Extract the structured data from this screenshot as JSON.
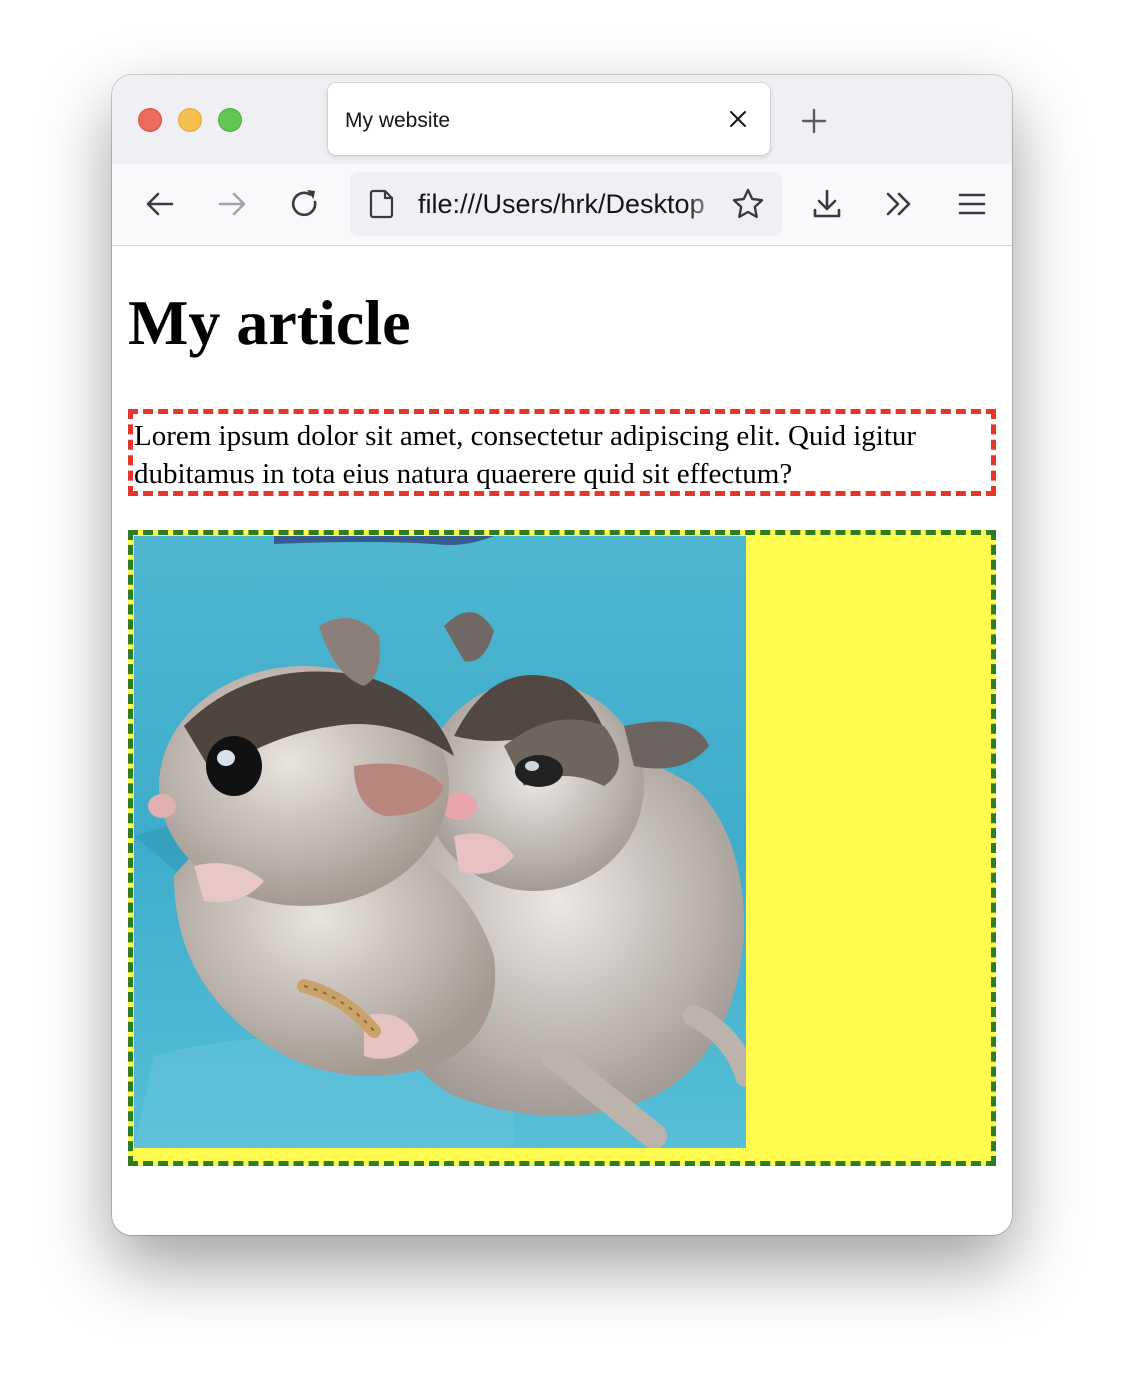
{
  "browser": {
    "tab": {
      "title": "My website"
    },
    "url": "file:///Users/hrk/Desktop"
  },
  "page": {
    "heading": "My article",
    "paragraph": "Lorem ipsum dolor sit amet, consectetur adipiscing elit. Quid igitur dubitamus in tota eius natura quaerere quid sit effectum?"
  },
  "colors": {
    "paragraph_border": "#e8352b",
    "figure_border": "#2e7d22",
    "figure_background": "#fffb4f"
  }
}
